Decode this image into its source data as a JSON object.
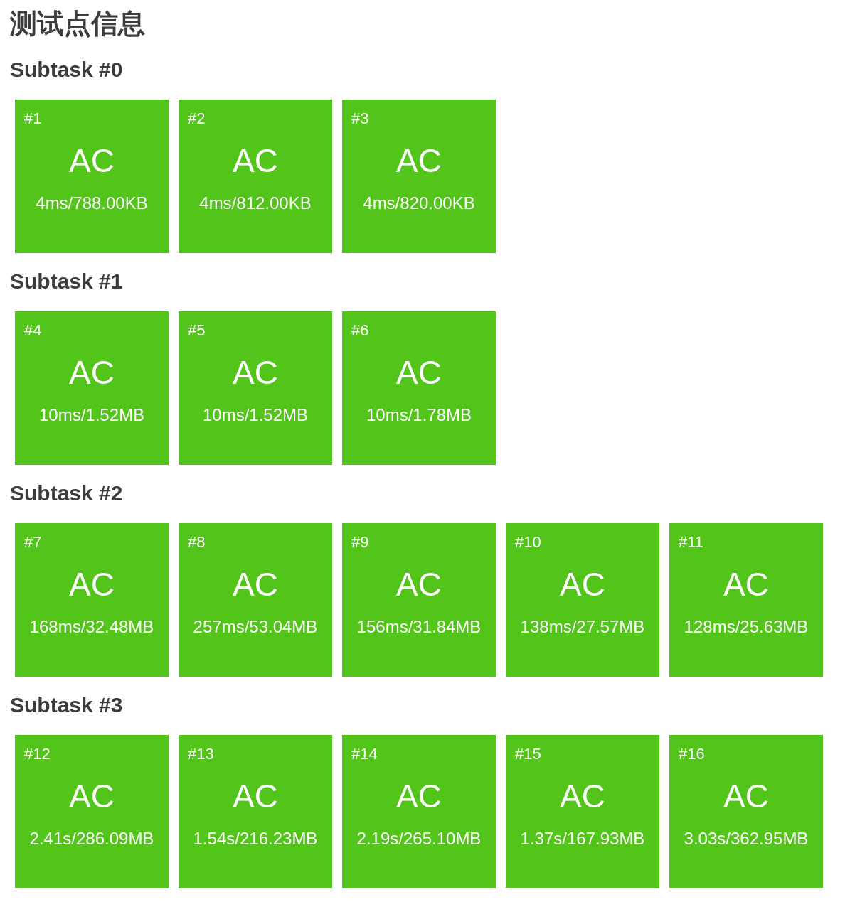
{
  "title": "测试点信息",
  "subtasks": [
    {
      "heading": "Subtask #0",
      "cases": [
        {
          "number": "#1",
          "verdict": "AC",
          "usage": "4ms/788.00KB"
        },
        {
          "number": "#2",
          "verdict": "AC",
          "usage": "4ms/812.00KB"
        },
        {
          "number": "#3",
          "verdict": "AC",
          "usage": "4ms/820.00KB"
        }
      ]
    },
    {
      "heading": "Subtask #1",
      "cases": [
        {
          "number": "#4",
          "verdict": "AC",
          "usage": "10ms/1.52MB"
        },
        {
          "number": "#5",
          "verdict": "AC",
          "usage": "10ms/1.52MB"
        },
        {
          "number": "#6",
          "verdict": "AC",
          "usage": "10ms/1.78MB"
        }
      ]
    },
    {
      "heading": "Subtask #2",
      "cases": [
        {
          "number": "#7",
          "verdict": "AC",
          "usage": "168ms/32.48MB"
        },
        {
          "number": "#8",
          "verdict": "AC",
          "usage": "257ms/53.04MB"
        },
        {
          "number": "#9",
          "verdict": "AC",
          "usage": "156ms/31.84MB"
        },
        {
          "number": "#10",
          "verdict": "AC",
          "usage": "138ms/27.57MB"
        },
        {
          "number": "#11",
          "verdict": "AC",
          "usage": "128ms/25.63MB"
        }
      ]
    },
    {
      "heading": "Subtask #3",
      "cases": [
        {
          "number": "#12",
          "verdict": "AC",
          "usage": "2.41s/286.09MB"
        },
        {
          "number": "#13",
          "verdict": "AC",
          "usage": "1.54s/216.23MB"
        },
        {
          "number": "#14",
          "verdict": "AC",
          "usage": "2.19s/265.10MB"
        },
        {
          "number": "#15",
          "verdict": "AC",
          "usage": "1.37s/167.93MB"
        },
        {
          "number": "#16",
          "verdict": "AC",
          "usage": "3.03s/362.95MB"
        }
      ]
    }
  ]
}
